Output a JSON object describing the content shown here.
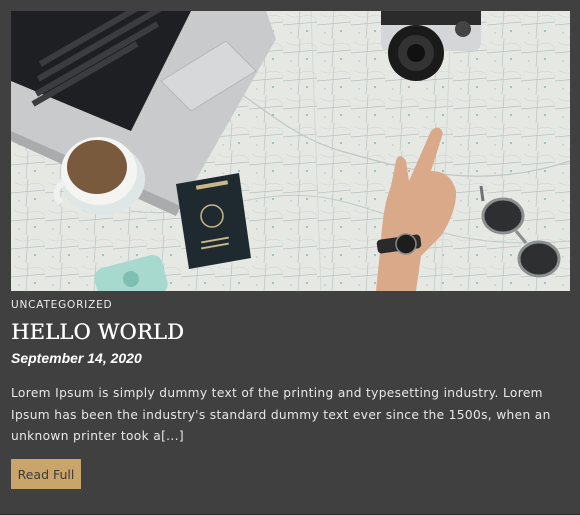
{
  "post": {
    "category": "Uncategorized",
    "title": "HELLO WORLD",
    "date": "September 14, 2020",
    "excerpt": "Lorem Ipsum is simply dummy text of the printing and typesetting industry. Lorem Ipsum has been the industry's standard dummy text ever since the 1500s, when an unknown printer took a[...]",
    "read_more_label": "Read Full"
  },
  "colors": {
    "card_background": "#404040",
    "button_background": "#c9a46b",
    "text_primary": "#ffffff"
  }
}
